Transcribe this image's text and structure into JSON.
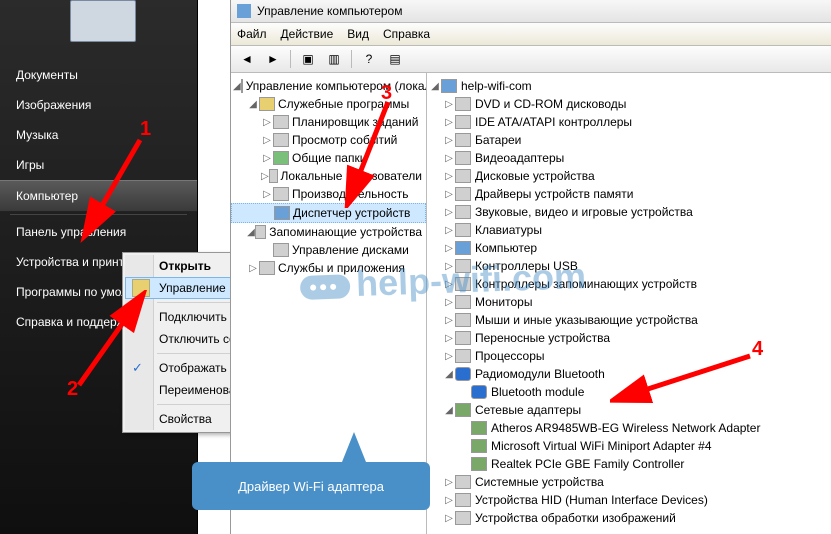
{
  "start_menu": {
    "items": [
      "Документы",
      "Изображения",
      "Музыка",
      "Игры",
      "Компьютер",
      "Панель управления",
      "Устройства и принтеры",
      "Программы по умолчанию",
      "Справка и поддержка"
    ]
  },
  "context_menu": {
    "open": "Открыть",
    "manage": "Управление",
    "map_drive": "Подключить сетевой диск...",
    "disconnect_drive": "Отключить сетевой диск...",
    "show_desktop": "Отображать на рабочем столе",
    "rename": "Переименовать",
    "properties": "Свойства"
  },
  "mmc": {
    "title": "Управление компьютером",
    "menu": {
      "file": "Файл",
      "action": "Действие",
      "view": "Вид",
      "help": "Справка"
    },
    "left_tree": {
      "root": "Управление компьютером (локальным)",
      "sys_tools": "Служебные программы",
      "task_sched": "Планировщик заданий",
      "event_viewer": "Просмотр событий",
      "shared": "Общие папки",
      "local_users": "Локальные пользователи",
      "perf": "Производительность",
      "dev_mgr": "Диспетчер устройств",
      "storage": "Запоминающие устройства",
      "disk_mgmt": "Управление дисками",
      "services": "Службы и приложения"
    },
    "devices": {
      "root": "help-wifi-com",
      "dvd": "DVD и CD-ROM дисководы",
      "ide": "IDE ATA/ATAPI контроллеры",
      "battery": "Батареи",
      "video": "Видеоадаптеры",
      "disk": "Дисковые устройства",
      "memory": "Драйверы устройств памяти",
      "sound": "Звуковые, видео и игровые устройства",
      "keyboard": "Клавиатуры",
      "computer": "Компьютер",
      "usb": "Контроллеры USB",
      "host": "Контроллеры запоминающих устройств",
      "monitor": "Мониторы",
      "mouse": "Мыши и иные указывающие устройства",
      "portable": "Переносные устройства",
      "cpu": "Процессоры",
      "bluetooth": "Радиомодули Bluetooth",
      "bt_module": "Bluetooth module",
      "netadapters": "Сетевые адаптеры",
      "nic1": "Atheros AR9485WB-EG Wireless Network Adapter",
      "nic2": "Microsoft Virtual WiFi Miniport Adapter #4",
      "nic3": "Realtek PCIe GBE Family Controller",
      "sysdev": "Системные устройства",
      "hid": "Устройства HID (Human Interface Devices)",
      "imaging": "Устройства обработки изображений"
    }
  },
  "annotations": {
    "n1": "1",
    "n2": "2",
    "n3": "3",
    "n4": "4"
  },
  "callout": {
    "text": "Драйвер Wi-Fi адаптера"
  },
  "watermark": {
    "text": "help-wifi.com"
  },
  "colors": {
    "arrow": "#ff0000",
    "callout": "#4a90c8"
  }
}
